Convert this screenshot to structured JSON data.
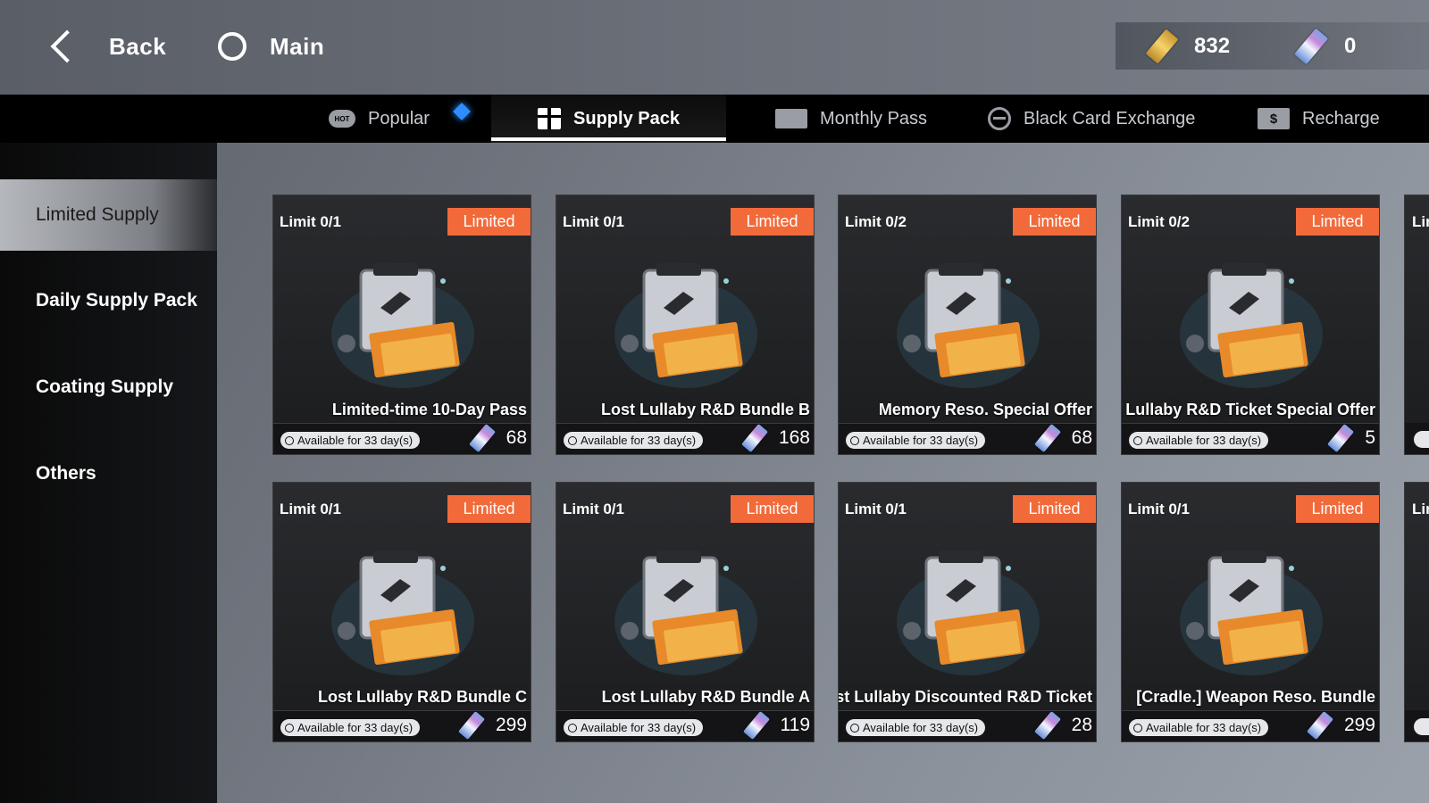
{
  "header": {
    "back_label": "Back",
    "main_label": "Main",
    "currency_gold": "832",
    "currency_ticket": "0"
  },
  "tabs": {
    "popular": "Popular",
    "supply_pack": "Supply Pack",
    "monthly_pass": "Monthly Pass",
    "black_card_exchange": "Black Card Exchange",
    "recharge": "Recharge",
    "hot_badge": "HOT",
    "recharge_symbol": "$"
  },
  "sidebar": {
    "items": [
      {
        "label": "Limited Supply"
      },
      {
        "label": "Daily Supply Pack"
      },
      {
        "label": "Coating Supply"
      },
      {
        "label": "Others"
      }
    ]
  },
  "cards": [
    {
      "limit": "Limit 0/1",
      "badge": "Limited",
      "name": "Limited-time 10-Day Pass",
      "availability": "Available for 33 day(s)",
      "price": "68"
    },
    {
      "limit": "Limit 0/1",
      "badge": "Limited",
      "name": "Lost Lullaby R&D Bundle B",
      "availability": "Available for 33 day(s)",
      "price": "168"
    },
    {
      "limit": "Limit 0/2",
      "badge": "Limited",
      "name": "Memory Reso. Special Offer",
      "availability": "Available for 33 day(s)",
      "price": "68"
    },
    {
      "limit": "Limit 0/2",
      "badge": "Limited",
      "name": "Lost Lullaby R&D Ticket Special Offer",
      "availability": "Available for 33 day(s)",
      "price": "5"
    },
    {
      "limit": "Limit 0/1",
      "badge": "Limited",
      "name": "Lost Lullaby R&D Bundle C",
      "availability": "Available for 33 day(s)",
      "price": "299"
    },
    {
      "limit": "Limit 0/1",
      "badge": "Limited",
      "name": "Lost Lullaby R&D Bundle A",
      "availability": "Available for 33 day(s)",
      "price": "119"
    },
    {
      "limit": "Limit 0/1",
      "badge": "Limited",
      "name": "Lost Lullaby Discounted R&D Ticket",
      "availability": "Available for 33 day(s)",
      "price": "28"
    },
    {
      "limit": "Limit 0/1",
      "badge": "Limited",
      "name": "[Cradle.] Weapon Reso. Bundle",
      "availability": "Available for 33 day(s)",
      "price": "299"
    }
  ],
  "partial_cards": [
    {
      "limit_fragment": "Lin"
    },
    {
      "limit_fragment": "Lin"
    }
  ]
}
